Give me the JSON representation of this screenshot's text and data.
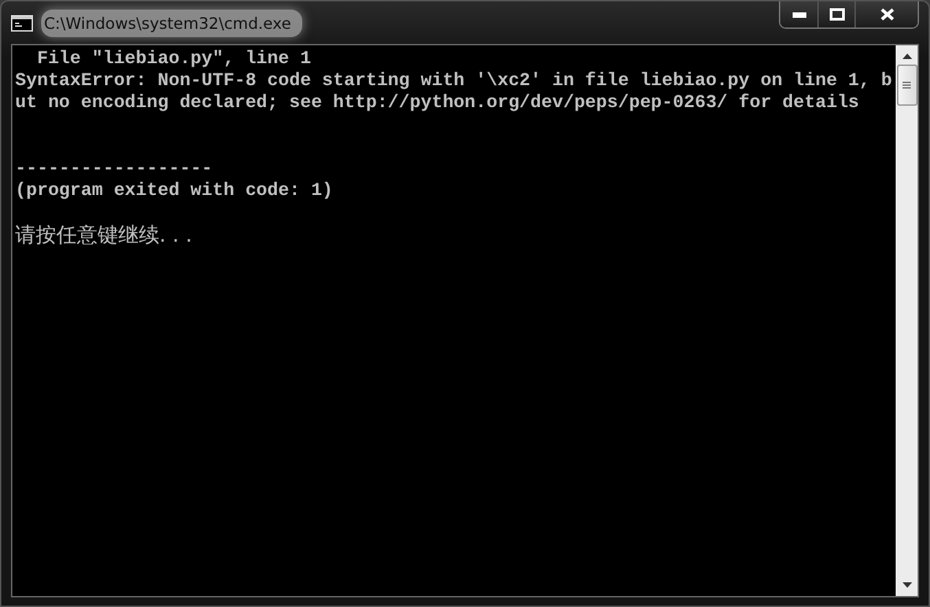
{
  "window": {
    "title": "C:\\Windows\\system32\\cmd.exe"
  },
  "console": {
    "lines": [
      {
        "kind": "text",
        "text": "  File \"liebiao.py\", line 1"
      },
      {
        "kind": "text",
        "text": "SyntaxError: Non-UTF-8 code starting with '\\xc2' in file liebiao.py on line 1, b"
      },
      {
        "kind": "text",
        "text": "ut no encoding declared; see http://python.org/dev/peps/pep-0263/ for details"
      },
      {
        "kind": "blank"
      },
      {
        "kind": "blank"
      },
      {
        "kind": "text",
        "text": "------------------"
      },
      {
        "kind": "text",
        "text": "(program exited with code: 1)"
      },
      {
        "kind": "blank"
      },
      {
        "kind": "cjk",
        "text": "请按任意键继续. . ."
      }
    ]
  }
}
